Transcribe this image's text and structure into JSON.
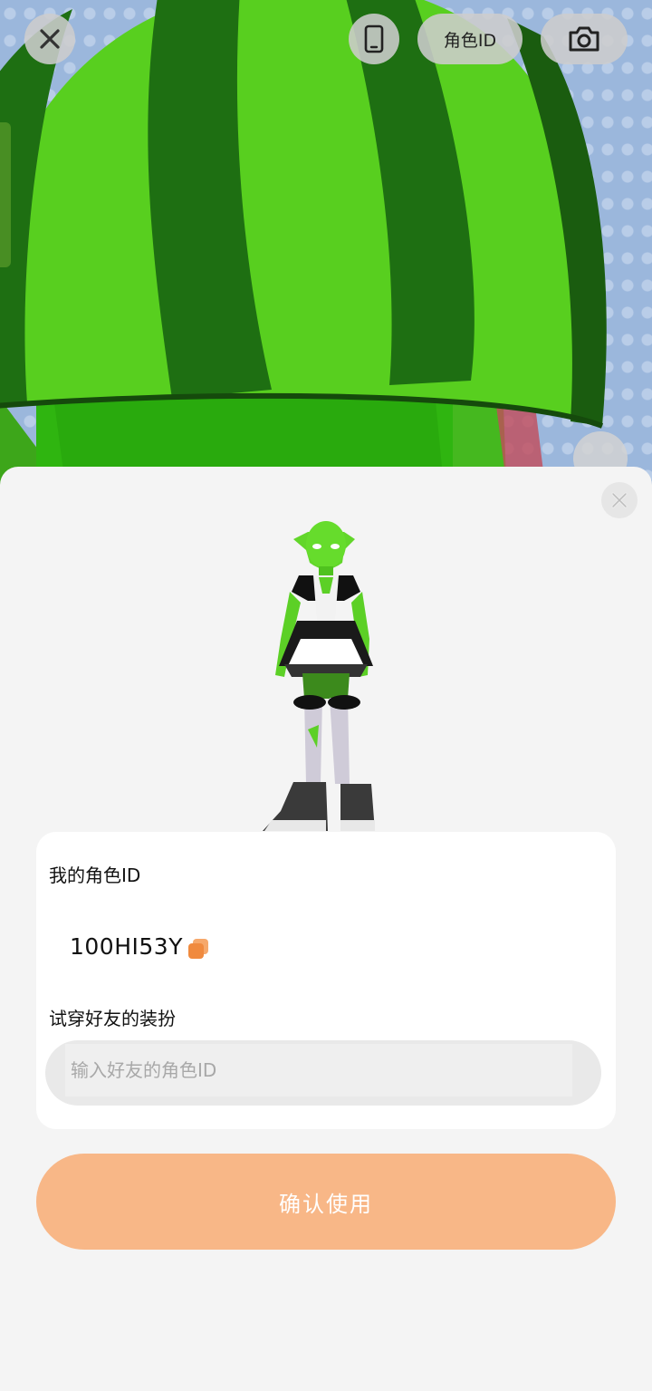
{
  "top_bar": {
    "close_icon": "close-icon",
    "phone_icon": "phone-icon",
    "role_id_label": "角色ID",
    "camera_icon": "camera-icon"
  },
  "sheet": {
    "my_role_id_label": "我的角色ID",
    "role_id_value": "100HI53Y",
    "copy_icon": "copy-icon",
    "try_on_label": "试穿好友的装扮",
    "friend_id_placeholder": "输入好友的角色ID",
    "friend_id_value": "",
    "confirm_label": "确认使用"
  },
  "colors": {
    "accent": "#f8b787",
    "melon_light": "#57cf1e",
    "melon_dark": "#1f6e12",
    "sheet_bg": "#f4f4f4",
    "card_bg": "#ffffff"
  }
}
